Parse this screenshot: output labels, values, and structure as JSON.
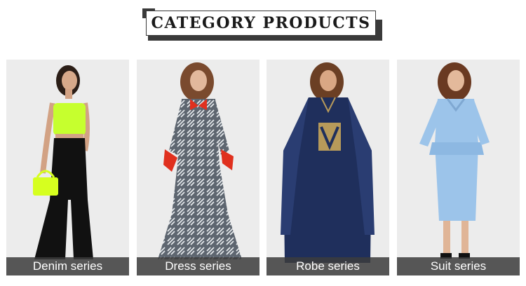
{
  "header": {
    "title": "CATEGORY PRODUCTS"
  },
  "cards": [
    {
      "label": "Denim series"
    },
    {
      "label": "Dress series"
    },
    {
      "label": "Robe series"
    },
    {
      "label": "Suit series"
    }
  ],
  "colors": {
    "card_bg": "#ececec",
    "label_bar": "#3c3c3c",
    "neon_top": "#c6ff2e",
    "denim": "#111111",
    "dress_print": "#7d8590",
    "dress_bow": "#e0301e",
    "robe": "#1f2f5c",
    "robe_gold": "#b79a5a",
    "suit": "#9cc4ea"
  }
}
